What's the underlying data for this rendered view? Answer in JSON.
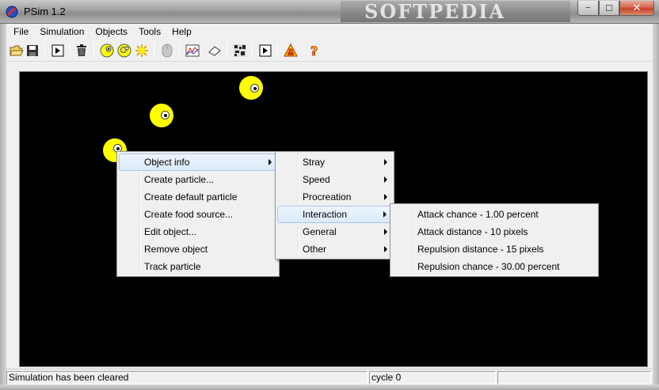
{
  "window": {
    "title": "PSim 1.2",
    "watermark": "SOFTPEDIA",
    "controls": {
      "minimize": "−",
      "maximize": "☐",
      "close": "✕"
    }
  },
  "menu": [
    "File",
    "Simulation",
    "Objects",
    "Tools",
    "Help"
  ],
  "toolbar": {
    "buttons": [
      "open-icon",
      "save-icon",
      "play-icon",
      "trash-icon",
      "particle-icon",
      "particle-double-icon",
      "food-source-icon",
      "mouse-icon",
      "chart-icon",
      "eraser-icon",
      "grid-icon",
      "run-icon",
      "warning-user-icon",
      "help-icon"
    ]
  },
  "context_menu": {
    "items": [
      "Object info",
      "Create particle...",
      "Create default particle",
      "Create food source...",
      "Edit object...",
      "Remove object",
      "Track particle"
    ]
  },
  "object_info_submenu": {
    "items": [
      "Stray",
      "Speed",
      "Procreation",
      "Interaction",
      "General",
      "Other"
    ]
  },
  "interaction_submenu": {
    "items": [
      "Attack chance - 1.00 percent",
      "Attack distance - 10 pixels",
      "Repulsion distance - 15 pixels",
      "Repulsion chance - 30.00 percent"
    ]
  },
  "status": {
    "message": "Simulation has been cleared",
    "cycle": "cycle 0"
  },
  "colors": {
    "canvas": "#000000",
    "particle": "#ffff00",
    "menu_highlight": "#dbeafa"
  }
}
